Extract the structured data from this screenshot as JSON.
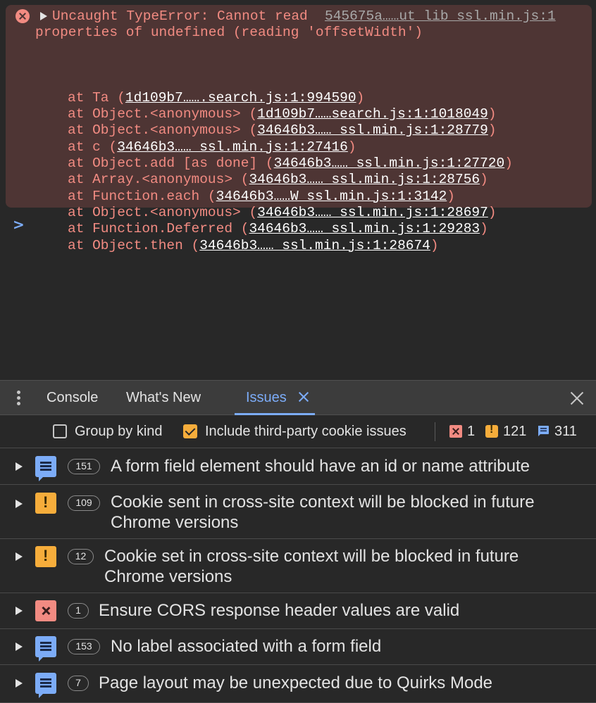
{
  "console": {
    "error_line1": "Uncaught TypeError: Cannot read",
    "error_source": "545675a……ut_lib_ssl.min.js:1",
    "error_line2": "properties of undefined (reading 'offsetWidth')",
    "stack": [
      {
        "prefix": "at Ta (",
        "link": "1d109b7…….search.js:1:994590",
        "suffix": ")"
      },
      {
        "prefix": "at Object.<anonymous> (",
        "link": "1d109b7……search.js:1:1018049",
        "suffix": ")"
      },
      {
        "prefix": "at Object.<anonymous> (",
        "link": "34646b3……_ssl.min.js:1:28779",
        "suffix": ")"
      },
      {
        "prefix": "at c (",
        "link": "34646b3……_ssl.min.js:1:27416",
        "suffix": ")"
      },
      {
        "prefix": "at Object.add [as done] (",
        "link": "34646b3……_ssl.min.js:1:27720",
        "suffix": ")"
      },
      {
        "prefix": "at Array.<anonymous> (",
        "link": "34646b3……_ssl.min.js:1:28756",
        "suffix": ")"
      },
      {
        "prefix": "at Function.each (",
        "link": "34646b3……W_ssl.min.js:1:3142",
        "suffix": ")"
      },
      {
        "prefix": "at Object.<anonymous> (",
        "link": "34646b3……_ssl.min.js:1:28697",
        "suffix": ")"
      },
      {
        "prefix": "at Function.Deferred (",
        "link": "34646b3……_ssl.min.js:1:29283",
        "suffix": ")"
      },
      {
        "prefix": "at Object.then (",
        "link": "34646b3……_ssl.min.js:1:28674",
        "suffix": ")"
      }
    ],
    "prompt": ">"
  },
  "drawer": {
    "tabs": [
      "Console",
      "What's New",
      "Issues"
    ],
    "active_tab": "Issues"
  },
  "toolbar": {
    "group_by_kind": {
      "label": "Group by kind",
      "checked": false
    },
    "third_party": {
      "label": "Include third-party cookie issues",
      "checked": true
    },
    "counts": {
      "errors": "1",
      "warnings": "121",
      "info": "311"
    }
  },
  "issues": [
    {
      "kind": "info",
      "count": "151",
      "title": "A form field element should have an id or name attribute"
    },
    {
      "kind": "warning",
      "count": "109",
      "title": "Cookie sent in cross-site context will be blocked in future Chrome versions"
    },
    {
      "kind": "warning",
      "count": "12",
      "title": "Cookie set in cross-site context will be blocked in future Chrome versions"
    },
    {
      "kind": "error",
      "count": "1",
      "title": "Ensure CORS response header values are valid"
    },
    {
      "kind": "info",
      "count": "153",
      "title": "No label associated with a form field"
    },
    {
      "kind": "info",
      "count": "7",
      "title": "Page layout may be unexpected due to Quirks Mode"
    }
  ],
  "colors": {
    "error_text": "#f28b82",
    "error_bg": "#4e3534",
    "accent": "#7cacf8",
    "warning": "#f6ad3b",
    "panel_bg": "#282828"
  }
}
